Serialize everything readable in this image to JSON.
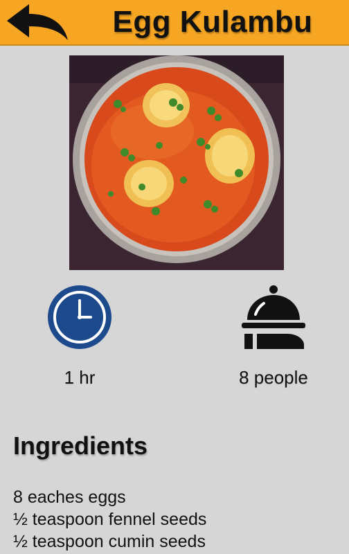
{
  "header": {
    "title": "Egg Kulambu"
  },
  "recipe": {
    "time": "1 hr",
    "serves": "8 people"
  },
  "ingredients": {
    "heading": "Ingredients",
    "items": [
      "8 eaches eggs",
      "½ teaspoon fennel seeds",
      "½ teaspoon cumin seeds"
    ]
  },
  "colors": {
    "header_bg": "#f7a623",
    "page_bg": "#d6d6d6",
    "clock_blue": "#1c4a8c"
  },
  "icons": {
    "back": "back-arrow-icon",
    "time": "clock-icon",
    "serves": "serving-cloche-icon"
  }
}
